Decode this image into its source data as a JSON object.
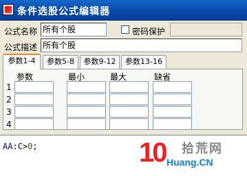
{
  "window": {
    "title": "条件选股公式编辑器"
  },
  "form": {
    "name_label": "公式名称",
    "name_value": "所有个股",
    "password_label": "密码保护",
    "password_checked": false,
    "desc_label": "公式描述",
    "desc_value": "所有个股"
  },
  "tabs": [
    {
      "label": "参数1-4",
      "active": true
    },
    {
      "label": "参数5-8",
      "active": false
    },
    {
      "label": "参数9-12",
      "active": false
    },
    {
      "label": "参数13-16",
      "active": false
    }
  ],
  "params": {
    "headers": [
      "参数",
      "最小",
      "最大",
      "缺省"
    ],
    "rows": [
      {
        "num": "1",
        "cells": [
          "",
          "",
          "",
          ""
        ]
      },
      {
        "num": "2",
        "cells": [
          "",
          "",
          "",
          ""
        ]
      },
      {
        "num": "3",
        "cells": [
          "",
          "",
          "",
          ""
        ]
      },
      {
        "num": "4",
        "cells": [
          "",
          "",
          "",
          ""
        ]
      }
    ]
  },
  "editor": {
    "code_var": "AA",
    "code_op1": ":",
    "code_c": "C",
    "code_op2": ">",
    "code_num": "0",
    "code_end": ";"
  },
  "watermark": {
    "mark": "10",
    "name": "拾荒网",
    "site": "Huang.CN"
  },
  "colors": {
    "title_bar": "#0a4fb0",
    "tab_accent": "#e68b2c",
    "watermark_red": "#ee2020",
    "watermark_blue": "#0e7fd6"
  }
}
